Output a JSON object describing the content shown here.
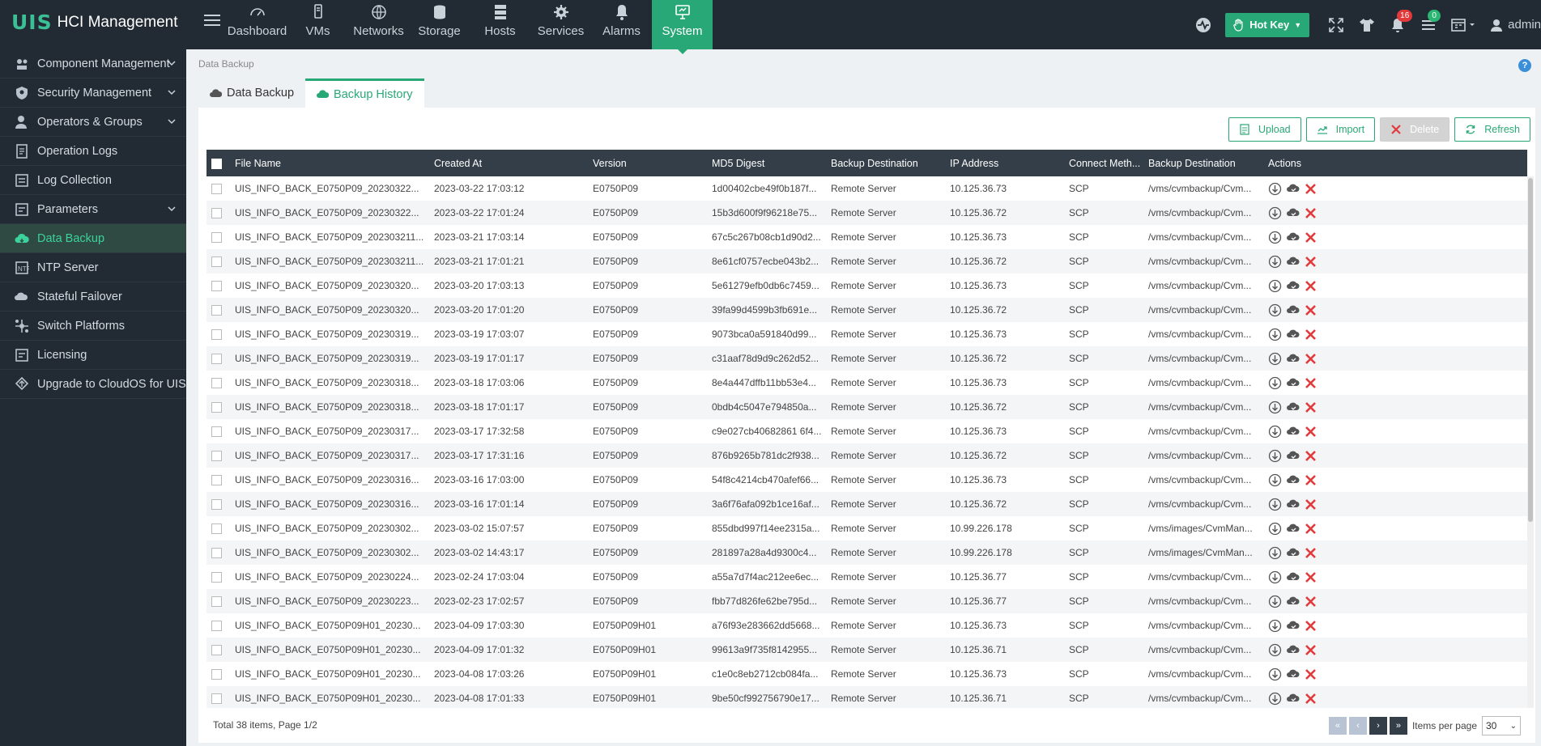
{
  "app": {
    "logo": "UIS",
    "title": "HCI Management"
  },
  "nav": [
    {
      "label": "Dashboard",
      "icon": "gauge-icon"
    },
    {
      "label": "VMs",
      "icon": "vm-icon"
    },
    {
      "label": "Networks",
      "icon": "globe-icon"
    },
    {
      "label": "Storage",
      "icon": "database-icon"
    },
    {
      "label": "Hosts",
      "icon": "server-icon"
    },
    {
      "label": "Services",
      "icon": "gear-icon"
    },
    {
      "label": "Alarms",
      "icon": "bell-icon"
    },
    {
      "label": "System",
      "icon": "monitor-icon",
      "active": true
    }
  ],
  "topright": {
    "hotkey": "Hot Key",
    "alarm_count": "16",
    "task_count": "0",
    "user": "admin"
  },
  "sidebar": {
    "items": [
      {
        "label": "Component Management",
        "icon": "components-icon",
        "expandable": true
      },
      {
        "label": "Security Management",
        "icon": "shield-icon",
        "expandable": true
      },
      {
        "label": "Operators & Groups",
        "icon": "user-icon",
        "expandable": true
      },
      {
        "label": "Operation Logs",
        "icon": "document-icon"
      },
      {
        "label": "Log Collection",
        "icon": "log-icon"
      },
      {
        "label": "Parameters",
        "icon": "parameters-icon",
        "expandable": true
      },
      {
        "label": "Data Backup",
        "icon": "cloud-backup-icon",
        "active": true
      },
      {
        "label": "NTP Server",
        "icon": "ntp-icon"
      },
      {
        "label": "Stateful Failover",
        "icon": "failover-icon"
      },
      {
        "label": "Switch Platforms",
        "icon": "switch-icon"
      },
      {
        "label": "Licensing",
        "icon": "license-icon"
      },
      {
        "label": "Upgrade to CloudOS for UIS",
        "icon": "upgrade-icon"
      }
    ]
  },
  "breadcrumb": "Data Backup",
  "tabs": [
    {
      "label": "Data Backup",
      "active": false
    },
    {
      "label": "Backup History",
      "active": true
    }
  ],
  "toolbar": {
    "upload": "Upload",
    "import": "Import",
    "delete": "Delete",
    "refresh": "Refresh"
  },
  "table": {
    "columns": [
      "File Name",
      "Created At",
      "Version",
      "MD5 Digest",
      "Backup Destination",
      "IP Address",
      "Connect Meth...",
      "Backup Destination",
      "Actions"
    ],
    "rows": [
      [
        "UIS_INFO_BACK_E0750P09_20230322...",
        "2023-03-22 17:03:12",
        "E0750P09",
        "1d00402cbe49f0b187f...",
        "Remote Server",
        "10.125.36.73",
        "SCP",
        "/vms/cvmbackup/Cvm..."
      ],
      [
        "UIS_INFO_BACK_E0750P09_20230322...",
        "2023-03-22 17:01:24",
        "E0750P09",
        "15b3d600f9f96218e75...",
        "Remote Server",
        "10.125.36.72",
        "SCP",
        "/vms/cvmbackup/Cvm..."
      ],
      [
        "UIS_INFO_BACK_E0750P09_202303211...",
        "2023-03-21 17:03:14",
        "E0750P09",
        "67c5c267b08cb1d90d2...",
        "Remote Server",
        "10.125.36.73",
        "SCP",
        "/vms/cvmbackup/Cvm..."
      ],
      [
        "UIS_INFO_BACK_E0750P09_202303211...",
        "2023-03-21 17:01:21",
        "E0750P09",
        "8e61cf0757ecbe043b2...",
        "Remote Server",
        "10.125.36.72",
        "SCP",
        "/vms/cvmbackup/Cvm..."
      ],
      [
        "UIS_INFO_BACK_E0750P09_20230320...",
        "2023-03-20 17:03:13",
        "E0750P09",
        "5e61279efb0db6c7459...",
        "Remote Server",
        "10.125.36.73",
        "SCP",
        "/vms/cvmbackup/Cvm..."
      ],
      [
        "UIS_INFO_BACK_E0750P09_20230320...",
        "2023-03-20 17:01:20",
        "E0750P09",
        "39fa99d4599b3fb691e...",
        "Remote Server",
        "10.125.36.72",
        "SCP",
        "/vms/cvmbackup/Cvm..."
      ],
      [
        "UIS_INFO_BACK_E0750P09_20230319...",
        "2023-03-19 17:03:07",
        "E0750P09",
        "9073bca0a591840d99...",
        "Remote Server",
        "10.125.36.73",
        "SCP",
        "/vms/cvmbackup/Cvm..."
      ],
      [
        "UIS_INFO_BACK_E0750P09_20230319...",
        "2023-03-19 17:01:17",
        "E0750P09",
        "c31aaf78d9d9c262d52...",
        "Remote Server",
        "10.125.36.72",
        "SCP",
        "/vms/cvmbackup/Cvm..."
      ],
      [
        "UIS_INFO_BACK_E0750P09_20230318...",
        "2023-03-18 17:03:06",
        "E0750P09",
        "8e4a447dffb11bb53e4...",
        "Remote Server",
        "10.125.36.73",
        "SCP",
        "/vms/cvmbackup/Cvm..."
      ],
      [
        "UIS_INFO_BACK_E0750P09_20230318...",
        "2023-03-18 17:01:17",
        "E0750P09",
        "0bdb4c5047e794850a...",
        "Remote Server",
        "10.125.36.72",
        "SCP",
        "/vms/cvmbackup/Cvm..."
      ],
      [
        "UIS_INFO_BACK_E0750P09_20230317...",
        "2023-03-17 17:32:58",
        "E0750P09",
        "c9e027cb40682861 6f4...",
        "Remote Server",
        "10.125.36.73",
        "SCP",
        "/vms/cvmbackup/Cvm..."
      ],
      [
        "UIS_INFO_BACK_E0750P09_20230317...",
        "2023-03-17 17:31:16",
        "E0750P09",
        "876b9265b781dc2f938...",
        "Remote Server",
        "10.125.36.72",
        "SCP",
        "/vms/cvmbackup/Cvm..."
      ],
      [
        "UIS_INFO_BACK_E0750P09_20230316...",
        "2023-03-16 17:03:00",
        "E0750P09",
        "54f8c4214cb470afef66...",
        "Remote Server",
        "10.125.36.73",
        "SCP",
        "/vms/cvmbackup/Cvm..."
      ],
      [
        "UIS_INFO_BACK_E0750P09_20230316...",
        "2023-03-16 17:01:14",
        "E0750P09",
        "3a6f76afa092b1ce16af...",
        "Remote Server",
        "10.125.36.72",
        "SCP",
        "/vms/cvmbackup/Cvm..."
      ],
      [
        "UIS_INFO_BACK_E0750P09_20230302...",
        "2023-03-02 15:07:57",
        "E0750P09",
        "855dbd997f14ee2315a...",
        "Remote Server",
        "10.99.226.178",
        "SCP",
        "/vms/images/CvmMan..."
      ],
      [
        "UIS_INFO_BACK_E0750P09_20230302...",
        "2023-03-02 14:43:17",
        "E0750P09",
        "281897a28a4d9300c4...",
        "Remote Server",
        "10.99.226.178",
        "SCP",
        "/vms/images/CvmMan..."
      ],
      [
        "UIS_INFO_BACK_E0750P09_20230224...",
        "2023-02-24 17:03:04",
        "E0750P09",
        "a55a7d7f4ac212ee6ec...",
        "Remote Server",
        "10.125.36.77",
        "SCP",
        "/vms/cvmbackup/Cvm..."
      ],
      [
        "UIS_INFO_BACK_E0750P09_20230223...",
        "2023-02-23 17:02:57",
        "E0750P09",
        "fbb77d826fe62be795d...",
        "Remote Server",
        "10.125.36.77",
        "SCP",
        "/vms/cvmbackup/Cvm..."
      ],
      [
        "UIS_INFO_BACK_E0750P09H01_20230...",
        "2023-04-09 17:03:30",
        "E0750P09H01",
        "a76f93e283662dd5668...",
        "Remote Server",
        "10.125.36.73",
        "SCP",
        "/vms/cvmbackup/Cvm..."
      ],
      [
        "UIS_INFO_BACK_E0750P09H01_20230...",
        "2023-04-09 17:01:32",
        "E0750P09H01",
        "99613a9f735f8142955...",
        "Remote Server",
        "10.125.36.71",
        "SCP",
        "/vms/cvmbackup/Cvm..."
      ],
      [
        "UIS_INFO_BACK_E0750P09H01_20230...",
        "2023-04-08 17:03:26",
        "E0750P09H01",
        "c1e0c8eb2712cb084fa...",
        "Remote Server",
        "10.125.36.73",
        "SCP",
        "/vms/cvmbackup/Cvm..."
      ],
      [
        "UIS_INFO_BACK_E0750P09H01_20230...",
        "2023-04-08 17:01:33",
        "E0750P09H01",
        "9be50cf992756790e17...",
        "Remote Server",
        "10.125.36.71",
        "SCP",
        "/vms/cvmbackup/Cvm..."
      ]
    ]
  },
  "footer": {
    "info": "Total 38 items, Page 1/2",
    "items_per_page_label": "Items per page",
    "items_per_page": "30"
  },
  "colors": {
    "accent": "#29a877",
    "topbar": "#222b33",
    "header": "#333e48",
    "danger": "#e2393b"
  }
}
